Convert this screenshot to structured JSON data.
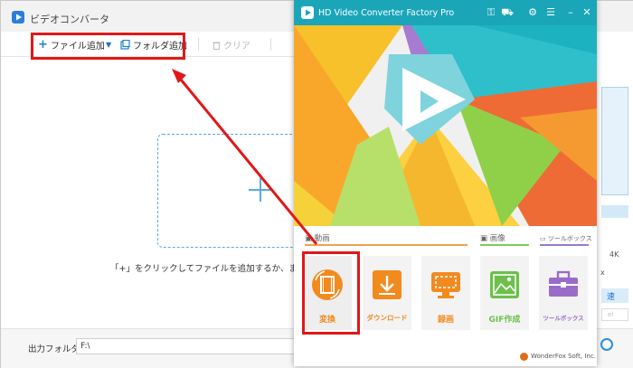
{
  "background_window": {
    "title": "ビデオコンバータ",
    "toolbar": {
      "add_file": "ファイル追加",
      "add_folder": "フォルダ追加",
      "clear": "クリア"
    },
    "drop_hint": "「+」をクリックしてファイルを追加するか、またはフ",
    "output_folder_label": "出力フォルダ：",
    "output_folder_value": "F:\\",
    "right_panel": {
      "resolution": "4K",
      "close_mark": "x",
      "speed": "速",
      "field_text": "el"
    }
  },
  "launcher": {
    "title": "HD Video Converter Factory Pro",
    "sections": {
      "video": "動画",
      "image": "画像",
      "toolbox": "ツールボックス"
    },
    "tiles": [
      {
        "label": "変換",
        "icon": "film-convert-icon",
        "color": "#f28a1e"
      },
      {
        "label": "ダウンロード",
        "icon": "download-icon",
        "color": "#f28a1e"
      },
      {
        "label": "録画",
        "icon": "screen-record-icon",
        "color": "#f28a1e"
      },
      {
        "label": "GIF作成",
        "icon": "image-gif-icon",
        "color": "#6cc04a"
      },
      {
        "label": "ツールボックス",
        "icon": "toolbox-icon",
        "color": "#9a6cc8"
      }
    ],
    "footer": "WonderFox Soft, Inc."
  },
  "colors": {
    "highlight": "#e01818",
    "accent_blue": "#1b7fd6",
    "video_orange": "#f28a1e",
    "image_green": "#6cc04a",
    "tool_purple": "#9a6cc8"
  }
}
